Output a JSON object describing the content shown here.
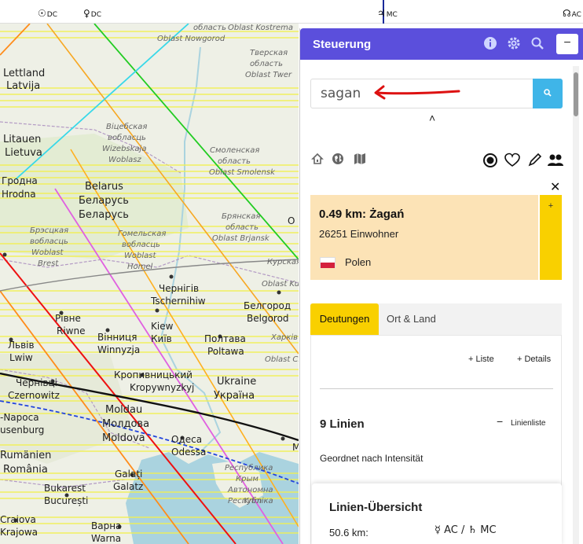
{
  "top_strip": {
    "markers": [
      {
        "symbol": "☉",
        "angle": "DC"
      },
      {
        "symbol": "♀",
        "angle": "DC"
      },
      {
        "symbol": "♃",
        "angle": "MC"
      },
      {
        "symbol": "☊",
        "angle": "AC"
      }
    ]
  },
  "map": {
    "labels": {
      "lettland": "Lettland",
      "latvija": "Latvija",
      "litauen": "Litauen",
      "lietuva": "Lietuva",
      "grodna": "Гродна",
      "hrodna": "Hrodna",
      "belarus": "Belarus",
      "belarus_ru": "Беларусь",
      "belarus_ru2": "Беларусь",
      "vitebsk_ru": "Віцебская",
      "vitebsk_ru2": "вобласць",
      "vitebsk_de": "Wizebskaja",
      "vitebsk_de2": "Woblasz",
      "brest_ru": "Брэсцкая",
      "brest_ru2": "вобласць",
      "brest_de": "Woblast",
      "brest_de2": "Brest",
      "homel_ru": "Гомельская",
      "homel_ru2": "вобласць",
      "homel_de": "Woblast",
      "homel_de2": "Homel",
      "novgorod_ru": "область",
      "novgorod_de": "Oblast Nowgorod",
      "tver_ru": "Тверская",
      "tver_ru2": "область",
      "tver_de": "Oblast Twer",
      "kostroma": "Oblast Kostrema",
      "smolensk_ru": "Смоленская",
      "smolensk_ru2": "область",
      "smolensk_de": "Oblast Smolensk",
      "bryansk_ru": "Брянская",
      "bryansk_ru2": "область",
      "bryansk_de": "Oblast Brjansk",
      "kursk_ru": "Курская",
      "kursk_ru2": "Oblast Ku",
      "chernihiv": "Чернігів",
      "tschernihiw": "Tschernihiw",
      "belgorod_ru": "Белгород",
      "belgorod": "Belgorod",
      "rivne_ua": "Рівне",
      "rivne": "Riwne",
      "kiew": "Kiew",
      "kyiv_ua": "Київ",
      "vinnytsia_ua": "Вінниця",
      "winnyzja": "Winnyzja",
      "poltava_ua": "Полтава",
      "poltawa": "Poltawa",
      "kharkiv_ua": "Харків",
      "kharkiv_obl": "Oblast Ch",
      "lviv_ua": "Львів",
      "lwiw": "Lwiw",
      "kropyvnytskyi_ua": "Кропивницький",
      "kropywnyzkyj": "Kropywnyzkyj",
      "ukraine": "Ukraine",
      "ukraina_ua": "Україна",
      "chernivtsi_ua": "Чернівці",
      "czernowitz": "Czernowitz",
      "napoca": "-Napoca",
      "usenburg": "usenburg",
      "moldau": "Moldau",
      "moldova_ro": "Молдова",
      "moldova": "Moldova",
      "odesa_ua": "Одеса",
      "odessa": "Odessa",
      "rumanien": "Rumänien",
      "romania": "România",
      "galati_ro": "Galați",
      "galatz": "Galatz",
      "bukarest": "Bukarest",
      "bucuresti": "București",
      "krym_ru": "Крым",
      "krym_de": "Республика",
      "krym_ua": "Автономна",
      "krym_kr": "Республіка",
      "krim": "Krim",
      "craiova_ro": "Craiova",
      "krajowa": "Krajowa",
      "varna_bg": "Варна",
      "warna": "Warna",
      "m_label": "M",
      "o_label": "O"
    }
  },
  "panel": {
    "title": "Steuerung",
    "header_icons": [
      "info-icon",
      "gear-icon",
      "search-icon"
    ],
    "minimize_label": "−",
    "search": {
      "value": "sagan",
      "button_icon": "search-icon"
    },
    "collapse_caret": "˄",
    "close_label": "✕",
    "result": {
      "title": "0.49 km: Żagań",
      "population": "26251 Einwohner",
      "country": "Polen",
      "add_label": "+"
    },
    "tabs": {
      "active": "Deutungen",
      "other": "Ort & Land"
    },
    "actions": {
      "list": "+ Liste",
      "details": "+ Details"
    },
    "lines": {
      "title": "9 Linien",
      "minus": "−",
      "list_label": "Linienliste",
      "sort_label": "Geordnet nach Intensität"
    },
    "overview": {
      "title": "Linien-Übersicht",
      "distance": "50.6 km:",
      "planets": "☿  AC / ♄  MC"
    }
  }
}
